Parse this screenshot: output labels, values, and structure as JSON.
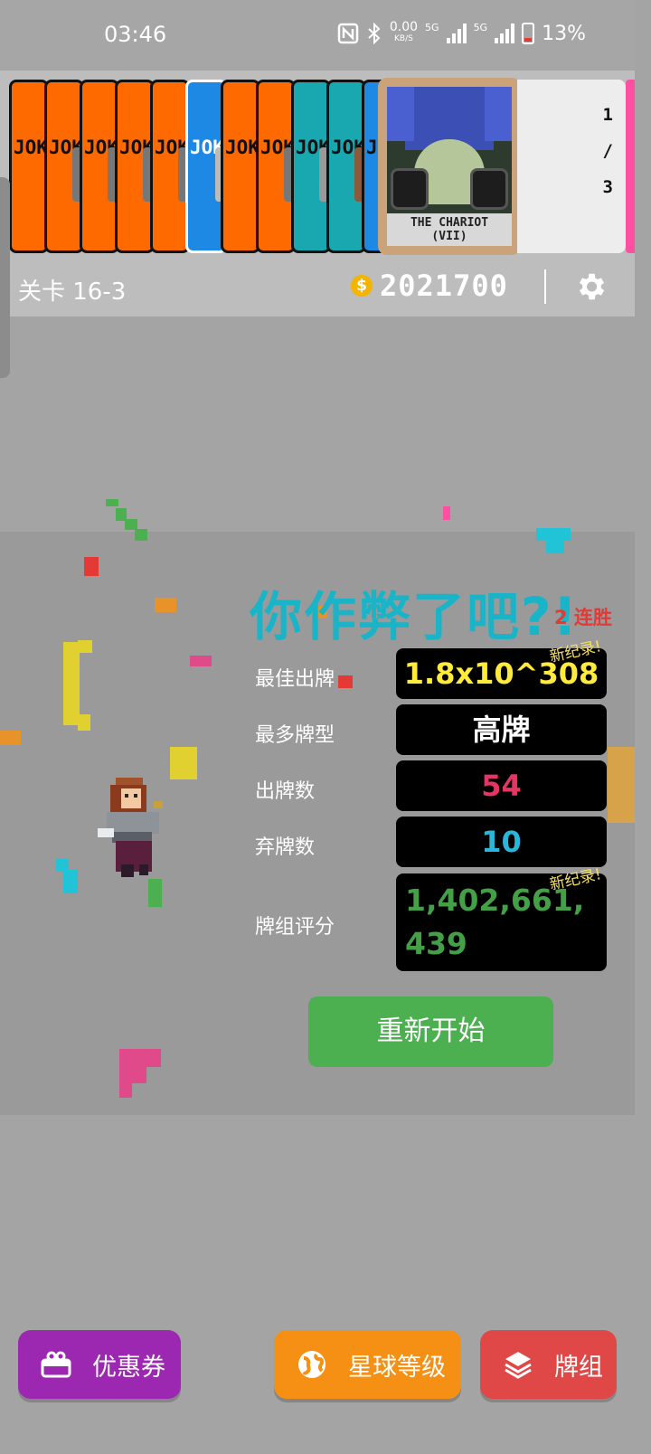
{
  "status_bar": {
    "time": "03:46",
    "net_speed": "0.00",
    "net_unit": "KB/S",
    "sim1_label": "5G",
    "sim2_label": "5G",
    "battery": "13%"
  },
  "joker_strip": {
    "card_label": "JOKER",
    "tarot_name_line1": "THE CHARIOT",
    "tarot_name_line2": "(VII)",
    "count_current": "1",
    "count_sep": "/",
    "count_total": "3"
  },
  "header": {
    "level": "关卡 16-3",
    "coin_symbol": "$",
    "money": "2021700"
  },
  "result": {
    "headline": "你作弊了吧?!",
    "streak": "2 连胜",
    "new_record_label": "新纪录!",
    "stats": [
      {
        "label": "最佳出牌",
        "value": "1.8x10^308",
        "color": "#ffeb3b"
      },
      {
        "label": "最多牌型",
        "value": "高牌",
        "color": "#ffffff"
      },
      {
        "label": "出牌数",
        "value": "54",
        "color": "#e53565"
      },
      {
        "label": "弃牌数",
        "value": "10",
        "color": "#29b6d8"
      },
      {
        "label": "牌组评分",
        "value": "1,402,661,439",
        "color": "#43a047"
      }
    ],
    "restart_label": "重新开始"
  },
  "bottom_nav": {
    "coupon_label": "优惠券",
    "planet_label": "星球等级",
    "deck_label": "牌组",
    "coupon_color": "#9c27b0",
    "planet_color": "#f59014",
    "deck_color": "#e04848"
  }
}
